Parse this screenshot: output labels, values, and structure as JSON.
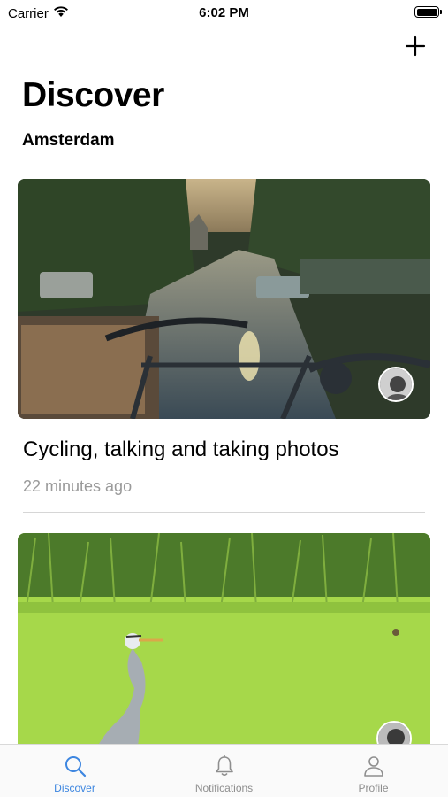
{
  "status_bar": {
    "carrier": "Carrier",
    "time": "6:02 PM"
  },
  "header": {
    "title": "Discover",
    "subtitle": "Amsterdam",
    "add_icon": "plus-icon"
  },
  "posts": [
    {
      "title": "Cycling, talking and taking photos",
      "time": "22 minutes ago"
    },
    {
      "title": "",
      "time": ""
    }
  ],
  "tabs": [
    {
      "label": "Discover",
      "icon": "search-icon",
      "active": true
    },
    {
      "label": "Notifications",
      "icon": "bell-icon",
      "active": false
    },
    {
      "label": "Profile",
      "icon": "person-icon",
      "active": false
    }
  ],
  "colors": {
    "accent": "#3d86e0",
    "inactive": "#8e8e8e",
    "secondary_text": "#9a9a9a"
  }
}
